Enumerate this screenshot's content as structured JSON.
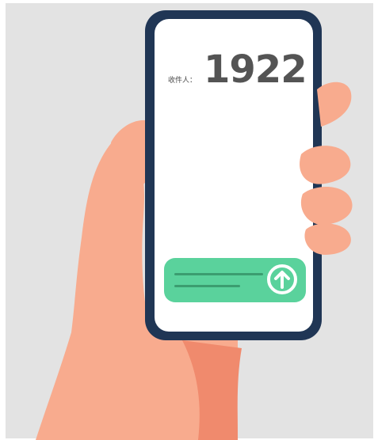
{
  "screen": {
    "recipient_label": "收件人：",
    "recipient_number": "1922"
  },
  "send_bar": {
    "icon": "arrow-up-circle-icon"
  },
  "colors": {
    "background": "#e3e3e3",
    "skin": "#f8ab8e",
    "skin_shadow": "#f08a6d",
    "phone_frame": "#203655",
    "screen": "#ffffff",
    "accent_green": "#5ad29c"
  }
}
